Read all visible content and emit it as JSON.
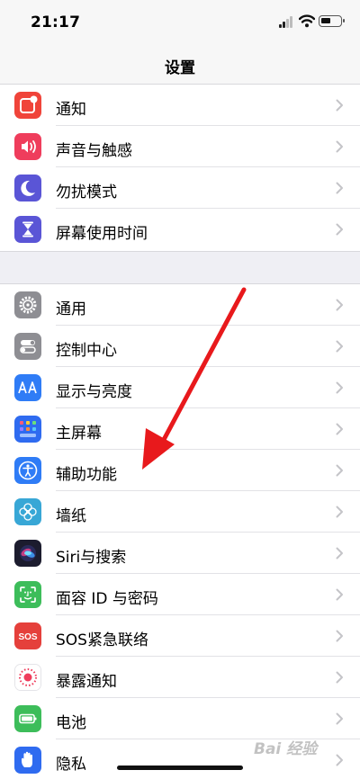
{
  "status_bar": {
    "time": "21:17",
    "signal_icon": "cellular-signal-icon",
    "wifi_icon": "wifi-icon",
    "battery_icon": "battery-icon"
  },
  "nav": {
    "title": "设置"
  },
  "groups": [
    {
      "items": [
        {
          "label": "通知",
          "icon": "notifications-icon",
          "color": "#f0443a"
        },
        {
          "label": "声音与触感",
          "icon": "sounds-icon",
          "color": "#ef3d5c"
        },
        {
          "label": "勿扰模式",
          "icon": "moon-icon",
          "color": "#5a55d6"
        },
        {
          "label": "屏幕使用时间",
          "icon": "hourglass-icon",
          "color": "#5a55d6"
        }
      ]
    },
    {
      "items": [
        {
          "label": "通用",
          "icon": "gear-icon",
          "color": "#8e8e93"
        },
        {
          "label": "控制中心",
          "icon": "toggles-icon",
          "color": "#8e8e93"
        },
        {
          "label": "显示与亮度",
          "icon": "display-icon",
          "color": "#2f7cf6"
        },
        {
          "label": "主屏幕",
          "icon": "home-screen-icon",
          "color": "#2f6bf0"
        },
        {
          "label": "辅助功能",
          "icon": "accessibility-icon",
          "color": "#2f7cf6"
        },
        {
          "label": "墙纸",
          "icon": "wallpaper-icon",
          "color": "#38a7d6"
        },
        {
          "label": "Siri与搜索",
          "icon": "siri-icon",
          "color": "#1c1c2e"
        },
        {
          "label": "面容 ID 与密码",
          "icon": "face-id-icon",
          "color": "#3dbd5a"
        },
        {
          "label": "SOS紧急联络",
          "icon": "sos-icon",
          "color": "#e5403b"
        },
        {
          "label": "暴露通知",
          "icon": "exposure-icon",
          "color": "#ffffff"
        },
        {
          "label": "电池",
          "icon": "battery-app-icon",
          "color": "#3dbd5a"
        },
        {
          "label": "隐私",
          "icon": "hand-icon",
          "color": "#2f6bf0"
        }
      ]
    }
  ],
  "annotation": {
    "icon": "red-arrow-icon",
    "color": "#e8191c"
  },
  "watermark": {
    "text": "Bai 经验"
  }
}
